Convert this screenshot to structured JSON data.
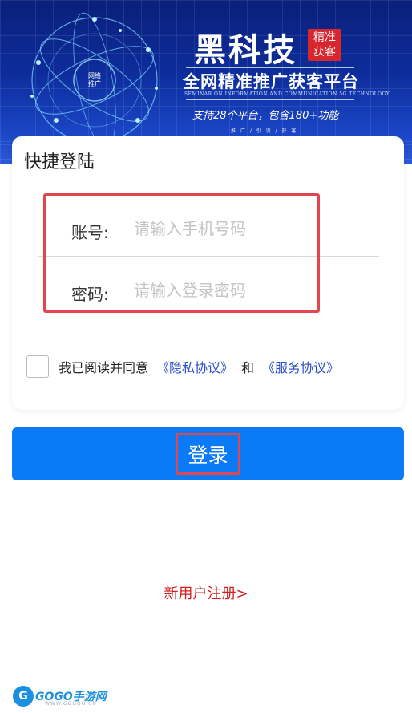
{
  "banner": {
    "brand_title": "黑科技",
    "badge_line1": "精准",
    "badge_line2": "获客",
    "subtitle": "全网精准推广获客平台",
    "english": "SEMINAR ON INFORMATION AND COMMUNICATION 5G TECHNOLOGY",
    "feature": "支持28个平台，包含180+功能",
    "tags": "推 广 / 引 流 / 获 客",
    "globe_label_1": "网络",
    "globe_label_2": "推广"
  },
  "login": {
    "title": "快捷登陆",
    "account_label": "账号:",
    "account_placeholder": "请输入手机号码",
    "account_value": "",
    "password_label": "密码:",
    "password_placeholder": "请输入登录密码",
    "password_value": ""
  },
  "agreement": {
    "prefix": "我已阅读并同意",
    "privacy_link": "《隐私协议》",
    "and": "和",
    "service_link": "《服务协议》",
    "checked": false
  },
  "actions": {
    "login_label": "登录",
    "register_label": "新用户注册>"
  },
  "watermark": {
    "text": "GOGO手游网",
    "sub": "WWW.GOGOO.CN"
  },
  "colors": {
    "primary_button": "#0a7af6",
    "highlight": "#e0474e",
    "link": "#2a4dc8",
    "register": "#d21e1e",
    "banner": "#0d2d9c"
  }
}
